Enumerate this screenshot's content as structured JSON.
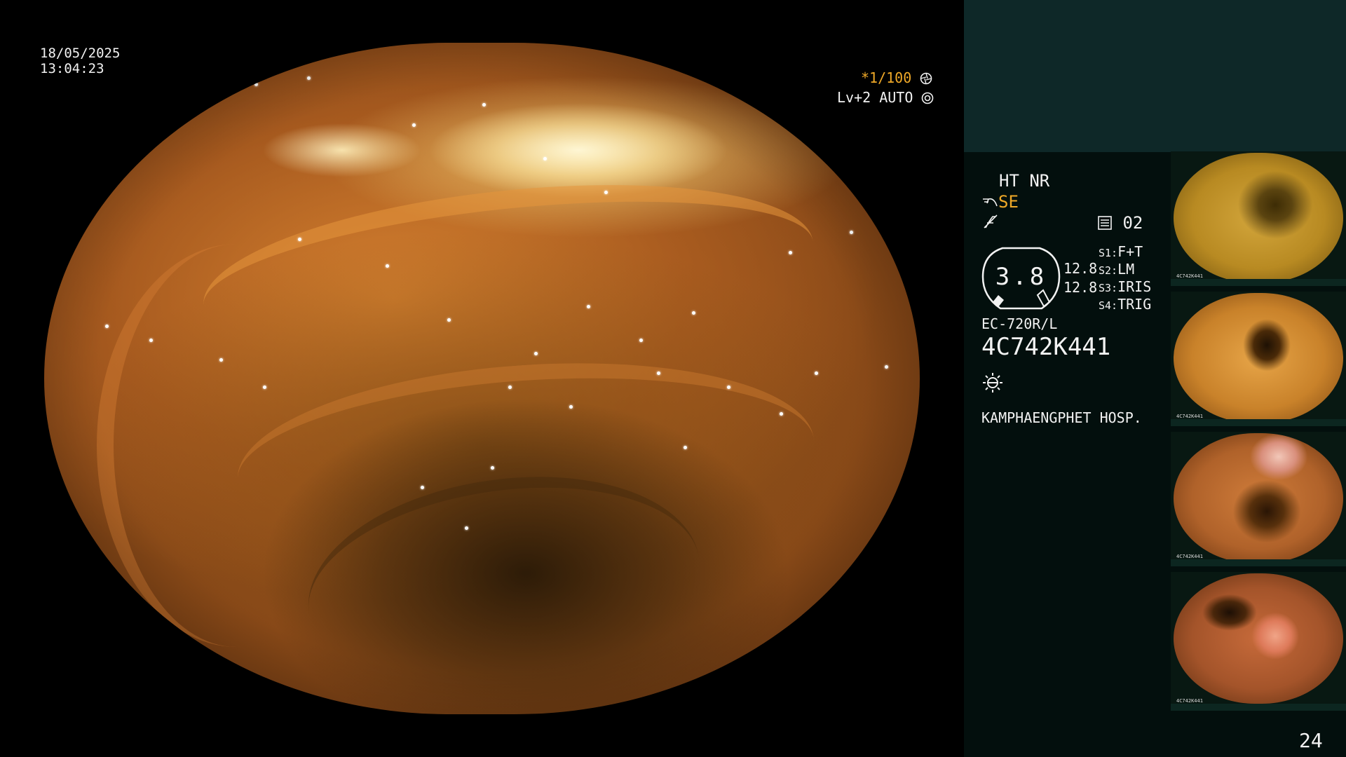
{
  "video": {
    "date": "18/05/2025",
    "time": "13:04:23",
    "shutter": "*1/100",
    "level": "Lv+2 AUTO"
  },
  "panel": {
    "mode_ht": "HT NR",
    "mode_se": "SE",
    "record_label": "02",
    "gauge_value": "3.8",
    "value_1": "12.8",
    "value_2": "12.8",
    "switches": [
      {
        "key": "S1:",
        "value": "F+T"
      },
      {
        "key": "S2:",
        "value": "LM"
      },
      {
        "key": "S3:",
        "value": "IRIS"
      },
      {
        "key": "S4:",
        "value": "TRIG"
      }
    ],
    "scope_model": "EC-720R/L",
    "scope_serial": "4C742K441",
    "hospital": "KAMPHAENGPHET HOSP.",
    "accent_color": "#f0a928"
  },
  "thumbnails": [
    {
      "caption": "4C742K441"
    },
    {
      "caption": "4C742K441"
    },
    {
      "caption": "4C742K441"
    },
    {
      "caption": "4C742K441"
    }
  ],
  "page_number": "24"
}
